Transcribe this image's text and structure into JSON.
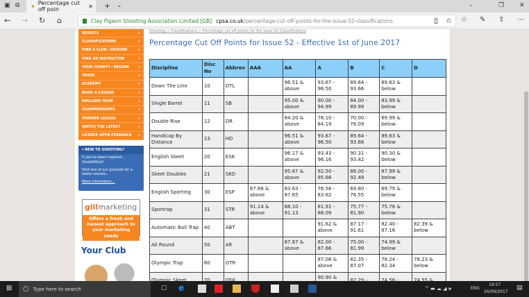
{
  "browser": {
    "tab_title": "Percentage cut off poin",
    "site_identity": "Clay Pigeon Shooting Association Limited [GB]",
    "url_domain": "cpsa.co.uk",
    "url_path": "/percentage-cut-off-points-for-the-issue-52-classifications"
  },
  "sidebar": {
    "menu": [
      "RESULTS",
      "CLASSIFICATIONS",
      "FIND A CLUB / GROUND",
      "FIND AN INSTRUCTOR",
      "YOUR COUNTY / REGION",
      "TRADE",
      "ACADEMY",
      "BOOK A COURSE",
      "ENGLAND TEAM",
      "CHAMPIONSHIPS",
      "PREMIER LEAGUE",
      "WATCH THE LATEST",
      "LICENCE APPN FEEDBACK"
    ],
    "new_box": {
      "heading": "NEW TO SHOOTING?",
      "line1": "If you've been inspired... GiveItAShot!",
      "line2": "Visit one of our grounds for a taster session...",
      "link": "More information..."
    },
    "ad": {
      "logo_a": "gill",
      "logo_b": "marketing",
      "text": "Offers a fresh and honest approach to your marketing needs"
    },
    "club": "Your Club"
  },
  "main": {
    "breadcrumb": [
      "Shooting",
      "Classifications",
      "Percentage cut off points for the Issue 52 Classifications"
    ],
    "title": "Percentage Cut Off Points for Issue 52 - Effective 1st of June 2017",
    "headers": [
      "Discipline",
      "Disc No",
      "Abbrev",
      "AAA",
      "AA",
      "A",
      "B",
      "C",
      "D"
    ],
    "rows": [
      [
        "Down The Line",
        "10",
        "DTL",
        "",
        "96.51 & above",
        "93.67 - 96.50",
        "89.64 - 93.66",
        "89.63 & below",
        ""
      ],
      [
        "Single Barrel",
        "11",
        "SB",
        "",
        "95.00 & above",
        "90.00 - 94.99",
        "84.00 - 89.99",
        "83.99 & below",
        ""
      ],
      [
        "Double Rise",
        "12",
        "DR",
        "",
        "84.20 & above",
        "78.10 - 84.19",
        "70.00 - 78.09",
        "69.99 & below",
        ""
      ],
      [
        "Handicap By Distance",
        "13",
        "HD",
        "",
        "96.51 & above",
        "93.67 - 96.50",
        "89.64 - 93.66",
        "89.63 & below",
        ""
      ],
      [
        "English Skeet",
        "20",
        "ESK",
        "",
        "96.17 & above",
        "93.43 - 96.16",
        "90.31 - 93.42",
        "90.30 & below",
        ""
      ],
      [
        "Skeet Doubles",
        "21",
        "SKD",
        "",
        "95.67 & above",
        "92.50 - 95.66",
        "88.00 - 92.49",
        "87.99 & below",
        ""
      ],
      [
        "English Sporting",
        "30",
        "ESP",
        "87.66 & above",
        "83.63 - 87.65",
        "76.56 - 83.62",
        "69.80 - 76.55",
        "69.79 & below",
        ""
      ],
      [
        "Sportrap",
        "31",
        "STR",
        "91.14 & above",
        "88.10 - 91.13",
        "81.91 - 88.09",
        "75.77 - 81.90",
        "75.76 & below",
        ""
      ],
      [
        "Automatic Ball Trap",
        "40",
        "ABT",
        "",
        "",
        "91.62 & above",
        "87.17 - 91.61",
        "82.40 - 87.16",
        "82.39 & below"
      ],
      [
        "All Round",
        "50",
        "AR",
        "",
        "87.67 & above",
        "82.00 - 87.66",
        "75.00 - 81.99",
        "74.99 & below",
        ""
      ],
      [
        "Olympic Trap",
        "60",
        "OTR",
        "",
        "",
        "87.08 & above",
        "82.35 - 87.07",
        "78.24 - 82.34",
        "78.23 & below"
      ],
      [
        "Olympic Skeet",
        "70",
        "OSK",
        "",
        "",
        "90.90 & above",
        "82.29 -",
        "74.56 -",
        "74.55 &"
      ]
    ]
  },
  "taskbar": {
    "search_placeholder": "Type here to search",
    "lang": "ENG",
    "time": "19:57",
    "date": "26/09/2017",
    "notif_count": "1"
  }
}
